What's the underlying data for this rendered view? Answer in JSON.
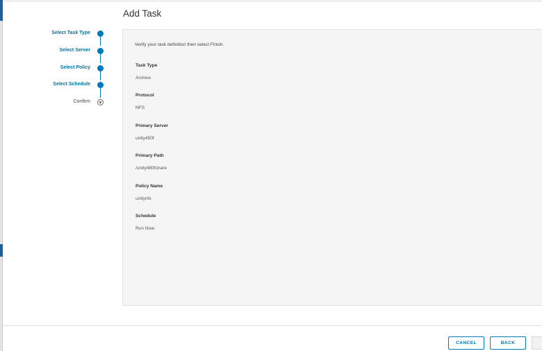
{
  "dialog": {
    "title": "Add Task"
  },
  "stepper": {
    "steps": [
      {
        "label": "Select Task Type",
        "state": "complete"
      },
      {
        "label": "Select Server",
        "state": "complete"
      },
      {
        "label": "Select Policy",
        "state": "complete"
      },
      {
        "label": "Select Schedule",
        "state": "complete"
      },
      {
        "label": "Confirm",
        "state": "current"
      }
    ]
  },
  "summary": {
    "intro": "Verify your task definition then select Finish.",
    "fields": [
      {
        "label": "Task Type",
        "value": "Archive"
      },
      {
        "label": "Protocol",
        "value": "NFS"
      },
      {
        "label": "Primary Server",
        "value": "unity450f"
      },
      {
        "label": "Primary Path",
        "value": "/unity480fshare"
      },
      {
        "label": "Policy Name",
        "value": "unitynfs"
      },
      {
        "label": "Schedule",
        "value": "Run Now"
      }
    ]
  },
  "footer": {
    "cancel_label": "CANCEL",
    "back_label": "BACK"
  },
  "colors": {
    "accent": "#0079b8",
    "step_label": "#0072a3",
    "panel_bg": "#f5f5f5"
  }
}
